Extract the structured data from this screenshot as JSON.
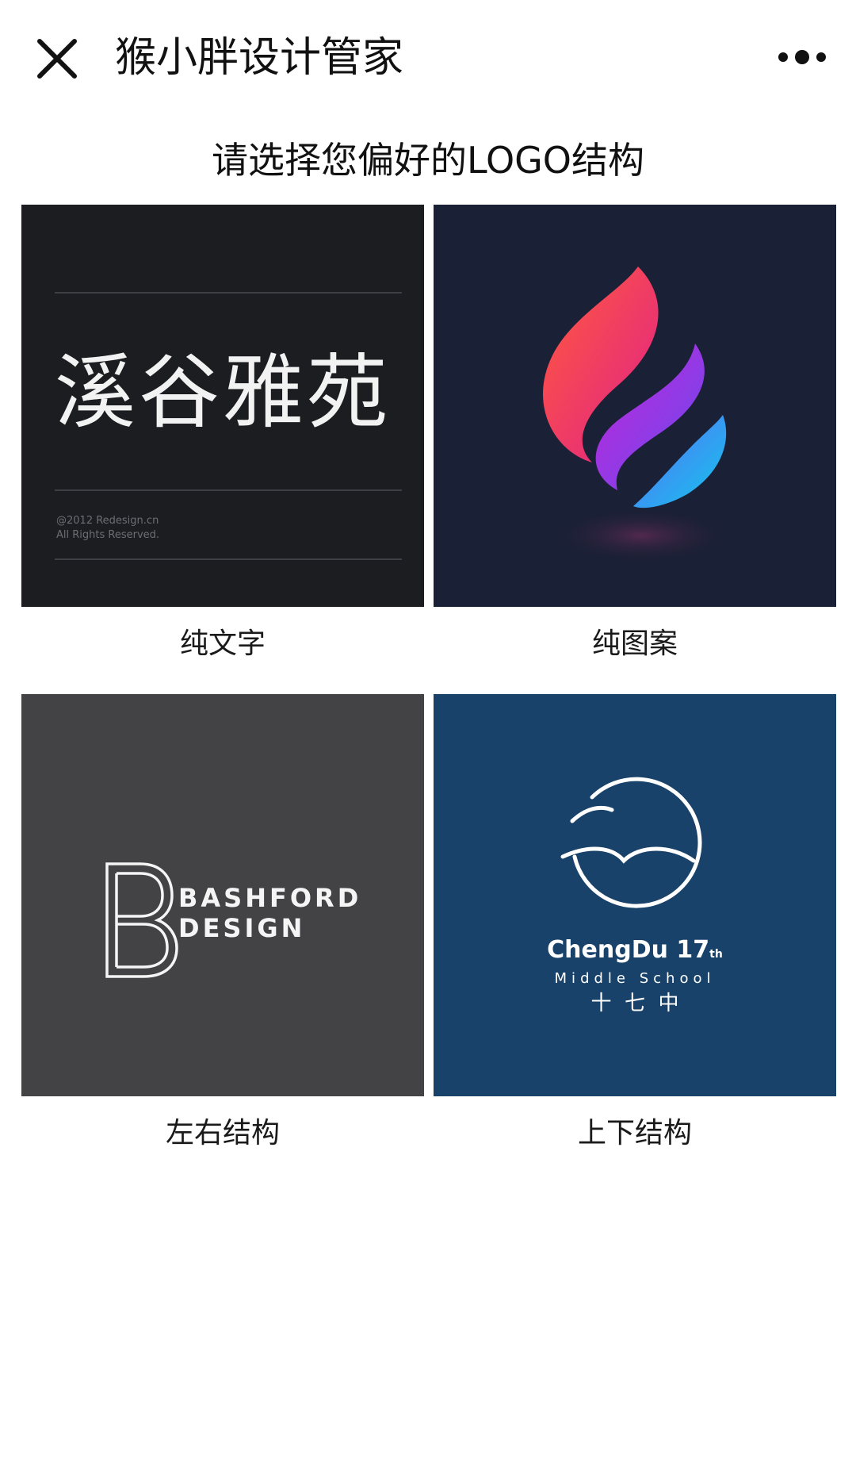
{
  "nav": {
    "title": "猴小胖设计管家",
    "close_icon": "close-icon",
    "more_icon": "more-dots-icon"
  },
  "heading": "请选择您偏好的LOGO结构",
  "options": [
    {
      "label": "纯文字",
      "preview": {
        "chinese_logo_text": "溪谷雅苑",
        "copyright_line1": "@2012 Redesign.cn",
        "copyright_line2": "All Rights Reserved.",
        "background": "#1b1d20"
      }
    },
    {
      "label": "纯图案",
      "preview": {
        "icon": "gradient-flame-logo",
        "background": "#1a2035"
      }
    },
    {
      "label": "左右结构",
      "preview": {
        "logo_line1": "BASHFORD",
        "logo_line2": "DESIGN",
        "icon": "b-monogram-icon",
        "background": "#434244"
      }
    },
    {
      "label": "上下结构",
      "preview": {
        "logo_name": "ChengDu 17",
        "logo_sup": "th",
        "logo_sub": "Middle School",
        "logo_chinese": "十  七  中",
        "icon": "circle-birds-logo",
        "background": "#18426a"
      }
    }
  ]
}
